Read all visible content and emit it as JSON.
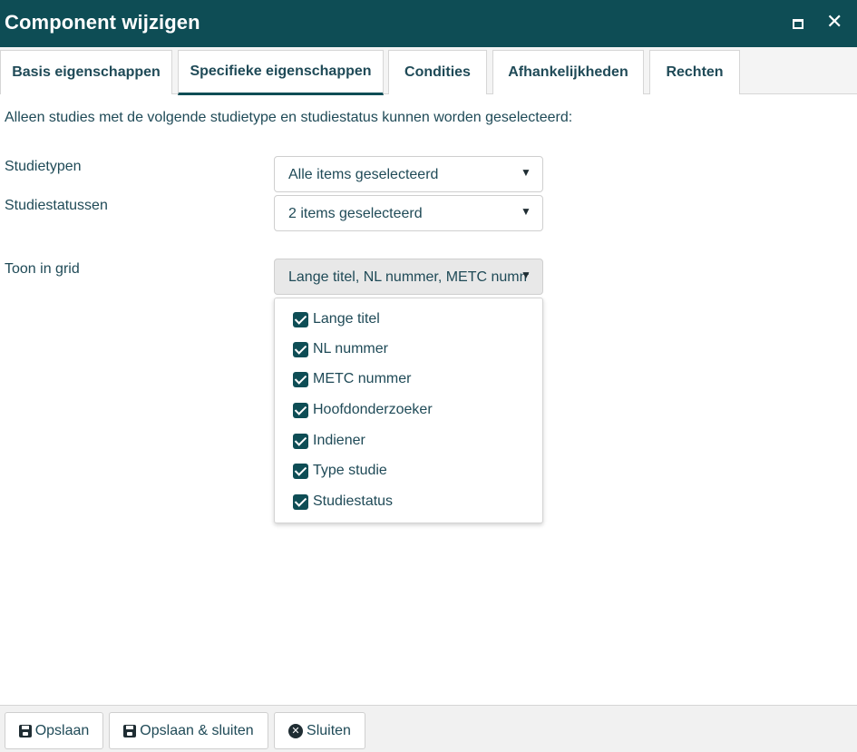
{
  "window": {
    "title": "Component wijzigen",
    "maximize_icon": "maximize-icon",
    "close_icon": "close-icon",
    "close_glyph": "✕"
  },
  "tabs": [
    {
      "label": "Basis eigenschappen",
      "active": false
    },
    {
      "label": "Specifieke eigenschappen",
      "active": true
    },
    {
      "label": "Condities",
      "active": false
    },
    {
      "label": "Afhankelijkheden",
      "active": false
    },
    {
      "label": "Rechten",
      "active": false
    }
  ],
  "intro": "Alleen studies met de volgende studietype en studiestatus kunnen worden geselecteerd:",
  "fields": {
    "studietypen": {
      "label": "Studietypen",
      "value": "Alle items geselecteerd"
    },
    "studiestatussen": {
      "label": "Studiestatussen",
      "value": "2 items geselecteerd"
    },
    "toon_in_grid": {
      "label": "Toon in grid",
      "value": "Lange titel, NL nummer, METC nummer"
    }
  },
  "grid_options": [
    {
      "label": "Lange titel",
      "checked": true
    },
    {
      "label": "NL nummer",
      "checked": true
    },
    {
      "label": "METC nummer",
      "checked": true
    },
    {
      "label": "Hoofdonderzoeker",
      "checked": true
    },
    {
      "label": "Indiener",
      "checked": true
    },
    {
      "label": "Type studie",
      "checked": true
    },
    {
      "label": "Studiestatus",
      "checked": true
    }
  ],
  "footer": {
    "save": "Opslaan",
    "save_close": "Opslaan & sluiten",
    "close": "Sluiten",
    "close_glyph": "✕"
  },
  "colors": {
    "titlebar": "#0e4d55",
    "text": "#1f4a57",
    "checkbox": "#0e4d55"
  }
}
